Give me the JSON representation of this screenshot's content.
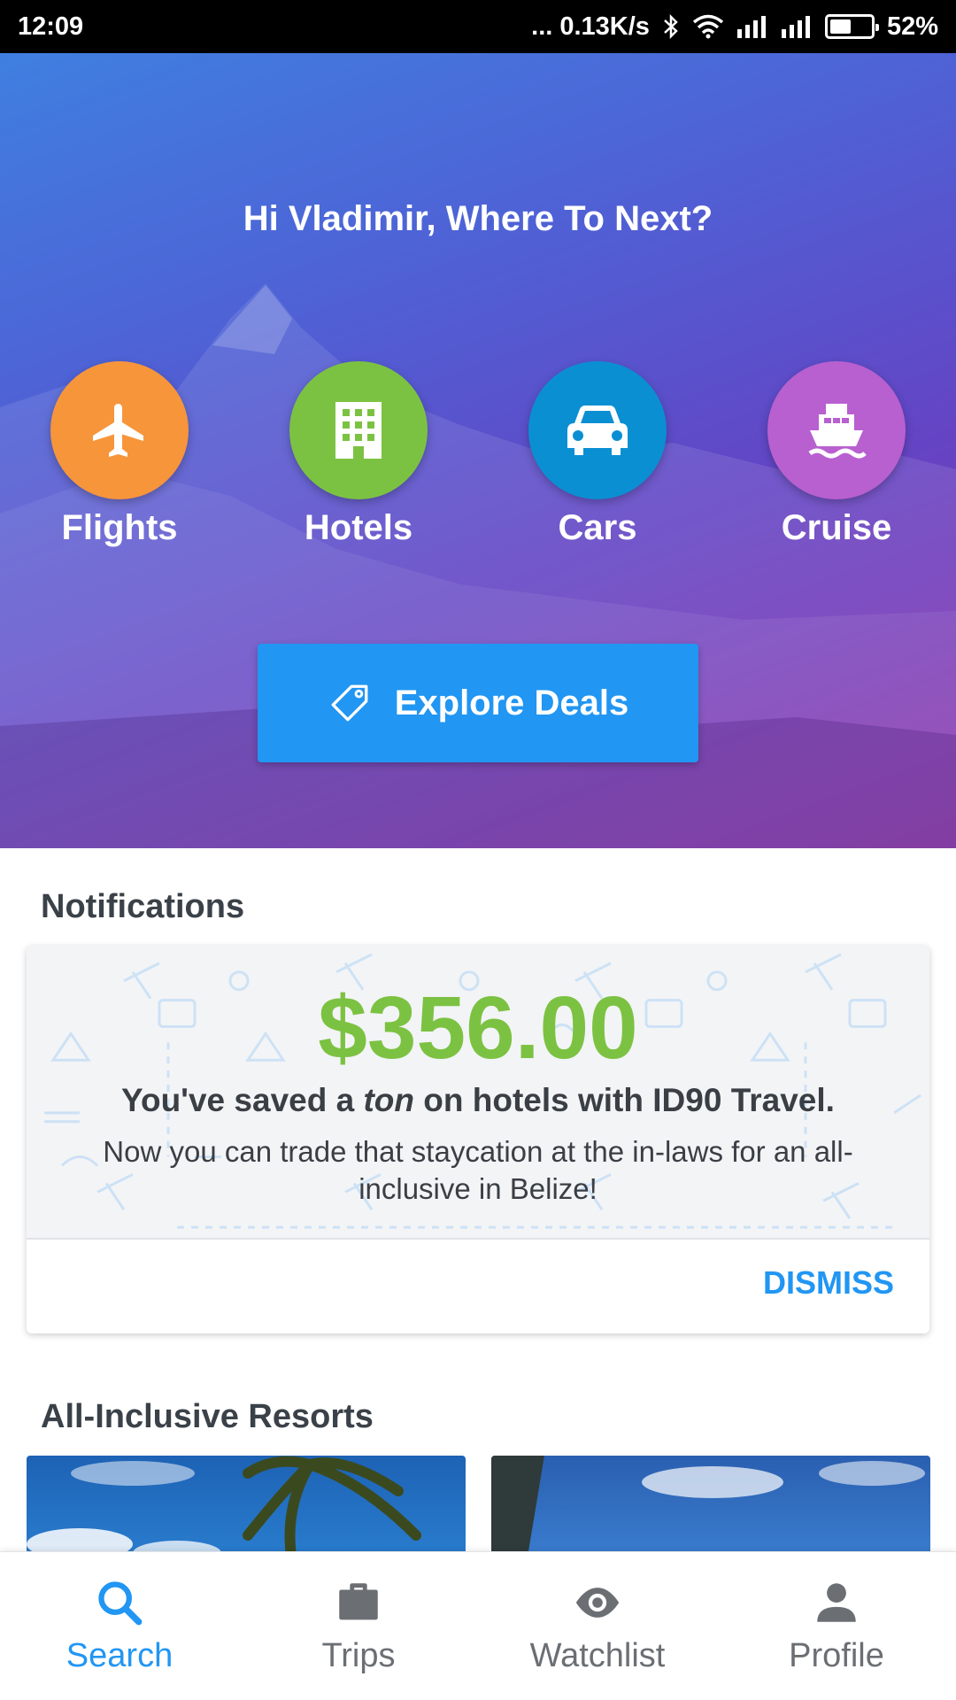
{
  "status_bar": {
    "time": "12:09",
    "network_speed": "... 0.13K/s",
    "battery_percent": "52%",
    "battery_level": 0.52,
    "icons": [
      "bluetooth-icon",
      "wifi-icon",
      "signal-icon",
      "signal-icon",
      "battery-icon"
    ]
  },
  "hero": {
    "greeting": "Hi Vladimir, Where To Next?",
    "categories": [
      {
        "label": "Flights",
        "icon": "airplane-icon",
        "color": "#f7953b"
      },
      {
        "label": "Hotels",
        "icon": "building-icon",
        "color": "#7cc242"
      },
      {
        "label": "Cars",
        "icon": "car-icon",
        "color": "#0b8fd3"
      },
      {
        "label": "Cruise",
        "icon": "ship-icon",
        "color": "#b860d0"
      }
    ],
    "deals_button": {
      "label": "Explore Deals",
      "icon": "tag-icon",
      "color": "#2196f3"
    }
  },
  "notifications": {
    "title": "Notifications",
    "amount": "$356.00",
    "saved_prefix": "You've saved a ",
    "saved_emphasis": "ton",
    "saved_suffix": " on hotels with ID90 Travel.",
    "message": "Now you can trade that staycation at the in-laws for an all-inclusive in Belize!",
    "dismiss_label": "DISMISS",
    "amount_color": "#7cc242"
  },
  "resorts": {
    "title": "All-Inclusive Resorts"
  },
  "bottom_nav": {
    "items": [
      {
        "label": "Search",
        "icon": "search-icon",
        "active": true
      },
      {
        "label": "Trips",
        "icon": "briefcase-icon",
        "active": false
      },
      {
        "label": "Watchlist",
        "icon": "eye-icon",
        "active": false
      },
      {
        "label": "Profile",
        "icon": "person-icon",
        "active": false
      }
    ],
    "active_color": "#2196f3"
  }
}
